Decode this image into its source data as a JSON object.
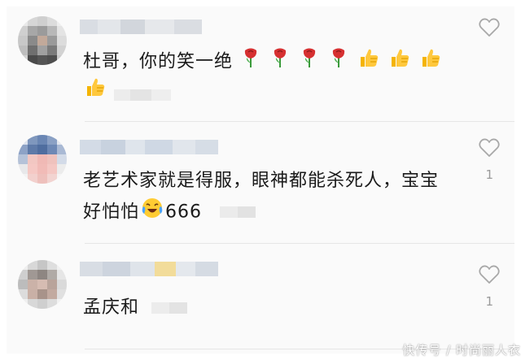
{
  "comments": [
    {
      "text_line1": "杜哥，你的笑一绝",
      "text_line2": ""
    },
    {
      "text_line1": "老艺术家就是得服，眼神都能杀死人，宝宝",
      "text_line2": "好怕怕",
      "text_suffix": "666",
      "like_count": "1"
    },
    {
      "text_line1": "孟庆和",
      "like_count": "1"
    }
  ],
  "watermark": "快传号 / 时尚丽人衣",
  "icons": {
    "like": "heart-outline-icon",
    "rose": "rose-emoji-icon",
    "thumbs_up": "thumbs-up-emoji-icon",
    "laugh_cry": "laughing-crying-emoji-icon"
  }
}
